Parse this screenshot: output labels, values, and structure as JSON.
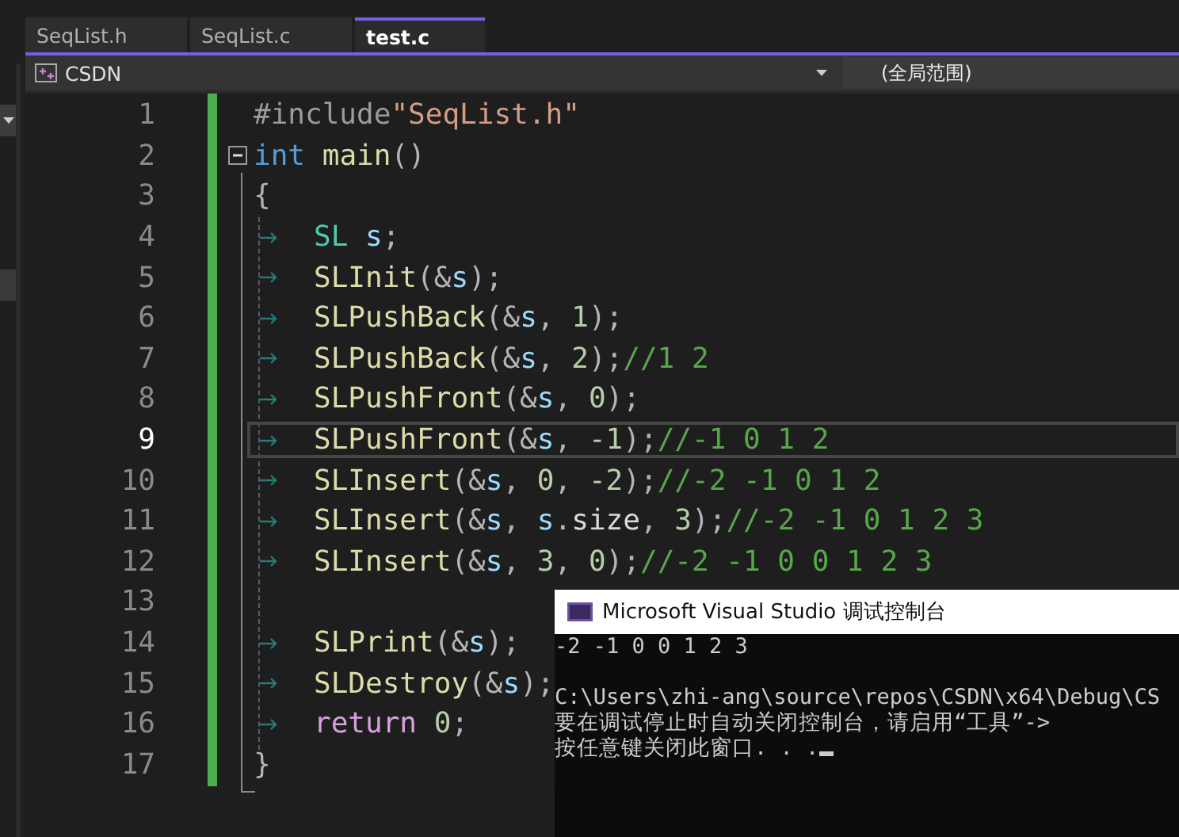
{
  "tabs": [
    {
      "label": "SeqList.h",
      "selected": false
    },
    {
      "label": "SeqList.c",
      "selected": false
    },
    {
      "label": "test.c",
      "selected": true
    }
  ],
  "navigation_bar": {
    "project": "CSDN",
    "scope": "(全局范围)"
  },
  "editor": {
    "lines": [
      {
        "number": "1",
        "current": false,
        "fold_start": false,
        "indented": false,
        "tokens": [
          {
            "kind": "preprocessor",
            "text": "#include"
          },
          {
            "kind": "string",
            "text": "\"SeqList.h\""
          }
        ]
      },
      {
        "number": "2",
        "current": false,
        "fold_start": true,
        "indented": false,
        "tokens": [
          {
            "kind": "keyword",
            "text": "int "
          },
          {
            "kind": "function",
            "text": "main"
          },
          {
            "kind": "punct",
            "text": "()"
          }
        ]
      },
      {
        "number": "3",
        "current": false,
        "fold_start": false,
        "indented": false,
        "tokens": [
          {
            "kind": "punct",
            "text": "{"
          }
        ]
      },
      {
        "number": "4",
        "current": false,
        "fold_start": false,
        "indented": true,
        "tokens": [
          {
            "kind": "type",
            "text": "SL "
          },
          {
            "kind": "variable",
            "text": "s"
          },
          {
            "kind": "punct",
            "text": ";"
          }
        ]
      },
      {
        "number": "5",
        "current": false,
        "fold_start": false,
        "indented": true,
        "tokens": [
          {
            "kind": "function",
            "text": "SLInit"
          },
          {
            "kind": "punct",
            "text": "(&"
          },
          {
            "kind": "variable",
            "text": "s"
          },
          {
            "kind": "punct",
            "text": ");"
          }
        ]
      },
      {
        "number": "6",
        "current": false,
        "fold_start": false,
        "indented": true,
        "tokens": [
          {
            "kind": "function",
            "text": "SLPushBack"
          },
          {
            "kind": "punct",
            "text": "(&"
          },
          {
            "kind": "variable",
            "text": "s"
          },
          {
            "kind": "punct",
            "text": ", "
          },
          {
            "kind": "number",
            "text": "1"
          },
          {
            "kind": "punct",
            "text": ");"
          }
        ]
      },
      {
        "number": "7",
        "current": false,
        "fold_start": false,
        "indented": true,
        "tokens": [
          {
            "kind": "function",
            "text": "SLPushBack"
          },
          {
            "kind": "punct",
            "text": "(&"
          },
          {
            "kind": "variable",
            "text": "s"
          },
          {
            "kind": "punct",
            "text": ", "
          },
          {
            "kind": "number",
            "text": "2"
          },
          {
            "kind": "punct",
            "text": ");"
          },
          {
            "kind": "comment",
            "text": "//1 2"
          }
        ]
      },
      {
        "number": "8",
        "current": false,
        "fold_start": false,
        "indented": true,
        "tokens": [
          {
            "kind": "function",
            "text": "SLPushFront"
          },
          {
            "kind": "punct",
            "text": "(&"
          },
          {
            "kind": "variable",
            "text": "s"
          },
          {
            "kind": "punct",
            "text": ", "
          },
          {
            "kind": "number",
            "text": "0"
          },
          {
            "kind": "punct",
            "text": ");"
          }
        ]
      },
      {
        "number": "9",
        "current": true,
        "fold_start": false,
        "indented": true,
        "tokens": [
          {
            "kind": "function",
            "text": "SLPushFront"
          },
          {
            "kind": "punct",
            "text": "(&"
          },
          {
            "kind": "variable",
            "text": "s"
          },
          {
            "kind": "punct",
            "text": ", "
          },
          {
            "kind": "number",
            "text": "-1"
          },
          {
            "kind": "punct",
            "text": ");"
          },
          {
            "kind": "comment",
            "text": "//-1 0 1 2"
          }
        ]
      },
      {
        "number": "10",
        "current": false,
        "fold_start": false,
        "indented": true,
        "tokens": [
          {
            "kind": "function",
            "text": "SLInsert"
          },
          {
            "kind": "punct",
            "text": "(&"
          },
          {
            "kind": "variable",
            "text": "s"
          },
          {
            "kind": "punct",
            "text": ", "
          },
          {
            "kind": "number",
            "text": "0"
          },
          {
            "kind": "punct",
            "text": ", "
          },
          {
            "kind": "number",
            "text": "-2"
          },
          {
            "kind": "punct",
            "text": ");"
          },
          {
            "kind": "comment",
            "text": "//-2 -1 0 1 2"
          }
        ]
      },
      {
        "number": "11",
        "current": false,
        "fold_start": false,
        "indented": true,
        "tokens": [
          {
            "kind": "function",
            "text": "SLInsert"
          },
          {
            "kind": "punct",
            "text": "(&"
          },
          {
            "kind": "variable",
            "text": "s"
          },
          {
            "kind": "punct",
            "text": ", "
          },
          {
            "kind": "variable",
            "text": "s"
          },
          {
            "kind": "punct",
            "text": "."
          },
          {
            "kind": "member",
            "text": "size"
          },
          {
            "kind": "punct",
            "text": ", "
          },
          {
            "kind": "number",
            "text": "3"
          },
          {
            "kind": "punct",
            "text": ");"
          },
          {
            "kind": "comment",
            "text": "//-2 -1 0 1 2 3"
          }
        ]
      },
      {
        "number": "12",
        "current": false,
        "fold_start": false,
        "indented": true,
        "tokens": [
          {
            "kind": "function",
            "text": "SLInsert"
          },
          {
            "kind": "punct",
            "text": "(&"
          },
          {
            "kind": "variable",
            "text": "s"
          },
          {
            "kind": "punct",
            "text": ", "
          },
          {
            "kind": "number",
            "text": "3"
          },
          {
            "kind": "punct",
            "text": ", "
          },
          {
            "kind": "number",
            "text": "0"
          },
          {
            "kind": "punct",
            "text": ");"
          },
          {
            "kind": "comment",
            "text": "//-2 -1 0 0 1 2 3"
          }
        ]
      },
      {
        "number": "13",
        "current": false,
        "fold_start": false,
        "indented": false
      },
      {
        "number": "14",
        "current": false,
        "fold_start": false,
        "indented": true,
        "tokens": [
          {
            "kind": "function",
            "text": "SLPrint"
          },
          {
            "kind": "punct",
            "text": "(&"
          },
          {
            "kind": "variable",
            "text": "s"
          },
          {
            "kind": "punct",
            "text": ");"
          }
        ]
      },
      {
        "number": "15",
        "current": false,
        "fold_start": false,
        "indented": true,
        "tokens": [
          {
            "kind": "function",
            "text": "SLDestroy"
          },
          {
            "kind": "punct",
            "text": "(&"
          },
          {
            "kind": "variable",
            "text": "s"
          },
          {
            "kind": "punct",
            "text": ");"
          }
        ]
      },
      {
        "number": "16",
        "current": false,
        "fold_start": false,
        "indented": true,
        "tokens": [
          {
            "kind": "control",
            "text": "return "
          },
          {
            "kind": "number",
            "text": "0"
          },
          {
            "kind": "punct",
            "text": ";"
          }
        ]
      },
      {
        "number": "17",
        "current": false,
        "fold_start": false,
        "indented": false,
        "tokens": [
          {
            "kind": "punct",
            "text": "}"
          }
        ]
      }
    ]
  },
  "console": {
    "title": "Microsoft Visual Studio 调试控制台",
    "output": "-2 -1 0 0 1 2 3",
    "messages": [
      "C:\\Users\\zhi-ang\\source\\repos\\CSDN\\x64\\Debug\\CS",
      "要在调试停止时自动关闭控制台，请启用“工具”->",
      "按任意键关闭此窗口. . ."
    ]
  }
}
